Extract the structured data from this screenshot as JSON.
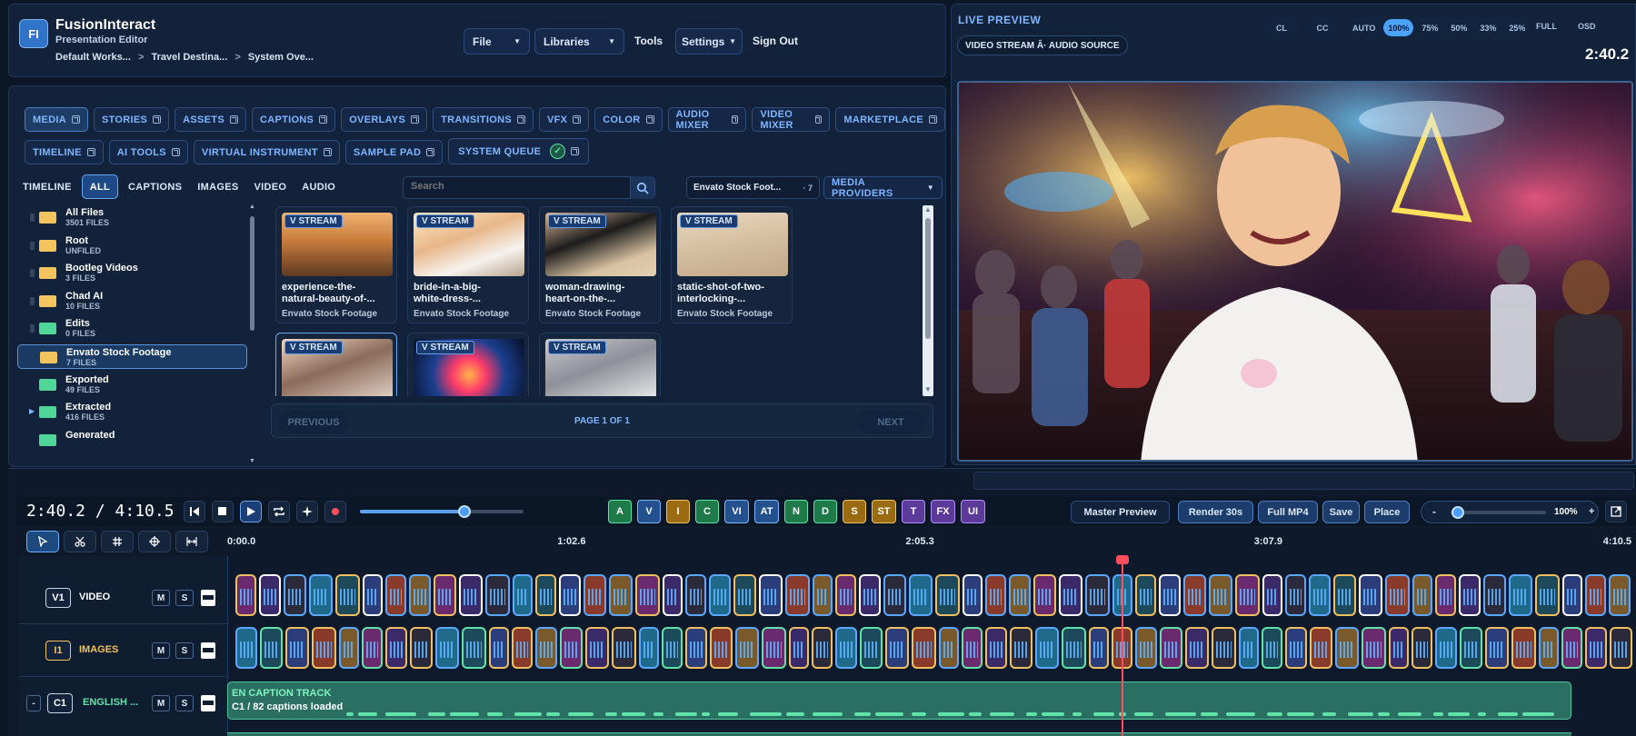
{
  "app": {
    "logo": "FI",
    "name": "FusionInteract",
    "subtitle": "Presentation Editor",
    "breadcrumb": [
      "Default Works...",
      "Travel Destina...",
      "System Ove..."
    ]
  },
  "menu": {
    "file": "File",
    "libraries": "Libraries",
    "tools": "Tools",
    "settings": "Settings",
    "signout": "Sign Out"
  },
  "tabs_row1": [
    "MEDIA",
    "STORIES",
    "ASSETS",
    "CAPTIONS",
    "OVERLAYS",
    "TRANSITIONS",
    "VFX",
    "COLOR",
    "AUDIO MIXER",
    "VIDEO MIXER",
    "MARKETPLACE"
  ],
  "tabs_row2": [
    "TIMELINE",
    "AI TOOLS",
    "VIRTUAL INSTRUMENT",
    "SAMPLE PAD",
    "SYSTEM QUEUE"
  ],
  "filters": {
    "items": [
      "TIMELINE",
      "ALL",
      "CAPTIONS",
      "IMAGES",
      "VIDEO",
      "AUDIO"
    ],
    "active": "ALL",
    "search_placeholder": "Search",
    "source": "Envato Stock Foot...",
    "source_count": "7",
    "providers": "MEDIA PROVIDERS"
  },
  "folders": [
    {
      "name": "All Files",
      "count": "3501 FILES",
      "color": "yellow"
    },
    {
      "name": "Root",
      "count": "UNFILED",
      "color": "yellow"
    },
    {
      "name": "Bootleg Videos",
      "count": "3 FILES",
      "color": "yellow"
    },
    {
      "name": "Chad AI",
      "count": "10 FILES",
      "color": "yellow"
    },
    {
      "name": "Edits",
      "count": "0 FILES",
      "color": "green"
    },
    {
      "name": "Envato Stock Footage",
      "count": "7 FILES",
      "color": "yellow"
    },
    {
      "name": "Exported",
      "count": "49 FILES",
      "color": "green"
    },
    {
      "name": "Extracted",
      "count": "416 FILES",
      "color": "green"
    },
    {
      "name": "Generated",
      "count": "",
      "color": "green"
    }
  ],
  "media": [
    {
      "tag": "V STREAM",
      "title1": "experience-the-",
      "title2": "natural-beauty-of-...",
      "source": "Envato Stock Footage"
    },
    {
      "tag": "V STREAM",
      "title1": "bride-in-a-big-",
      "title2": "white-dress-...",
      "source": "Envato Stock Footage"
    },
    {
      "tag": "V STREAM",
      "title1": "woman-drawing-",
      "title2": "heart-on-the-...",
      "source": "Envato Stock Footage"
    },
    {
      "tag": "V STREAM",
      "title1": "static-shot-of-two-",
      "title2": "interlocking-...",
      "source": "Envato Stock Footage"
    },
    {
      "tag": "V STREAM",
      "title1": "",
      "title2": "",
      "source": ""
    },
    {
      "tag": "V STREAM",
      "title1": "",
      "title2": "",
      "source": ""
    },
    {
      "tag": "V STREAM",
      "title1": "",
      "title2": "",
      "source": ""
    }
  ],
  "pager": {
    "prev": "PREVIOUS",
    "label": "PAGE 1 OF 1",
    "next": "NEXT"
  },
  "preview": {
    "title": "LIVE PREVIEW",
    "stream": "VIDEO STREAM Â· AUDIO SOURCE",
    "cl": "CL",
    "cc": "CC",
    "zoom": [
      "AUTO",
      "100%",
      "75%",
      "50%",
      "33%",
      "25%"
    ],
    "zoom_active": "100%",
    "full": "FULL",
    "osd": "OSD",
    "time": "2:40.2"
  },
  "transport": {
    "timecode": "2:40.2 / 4:10.5",
    "scrub_fraction": 0.64,
    "track_buttons": [
      "A",
      "V",
      "I",
      "C",
      "VI",
      "AT",
      "N",
      "D",
      "S",
      "ST",
      "T",
      "FX",
      "UI"
    ],
    "master_preview": "Master Preview",
    "render": "Render 30s",
    "full_mp4": "Full MP4",
    "save": "Save",
    "place": "Place",
    "zoom_fraction": 0.08,
    "zoom_label": "100%",
    "minus": "-",
    "plus": "+"
  },
  "ruler": [
    "0:00.0",
    "1:02.6",
    "2:05.3",
    "3:07.9",
    "4:10.5"
  ],
  "playhead_fraction": 0.641,
  "tracks": [
    {
      "id": "V1",
      "name": "VIDEO",
      "color": "#ffffff"
    },
    {
      "id": "I1",
      "name": "IMAGES",
      "color": "#f2c45c"
    },
    {
      "id": "C1",
      "name": "ENGLISH ...",
      "color": "#5fe3a8"
    }
  ],
  "track_ms": {
    "m": "M",
    "s": "S",
    "collapse": "-"
  },
  "caption_track": {
    "title": "EN CAPTION TRACK",
    "info": "C1 / 82 captions loaded"
  }
}
